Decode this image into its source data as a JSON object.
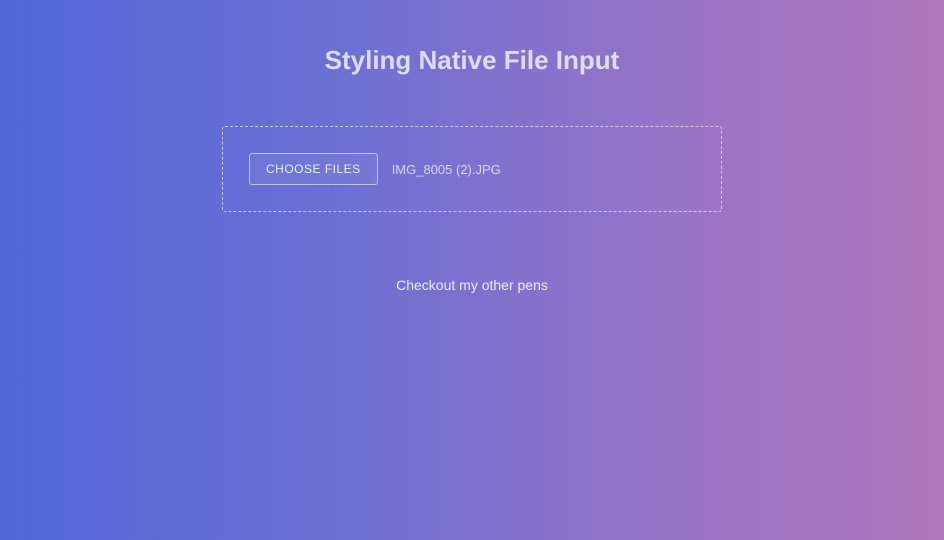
{
  "title": "Styling Native File Input",
  "fileInput": {
    "buttonLabel": "CHOOSE FILES",
    "selectedFileName": "IMG_8005 (2).JPG"
  },
  "footer": {
    "linkText": "Checkout my other pens"
  }
}
